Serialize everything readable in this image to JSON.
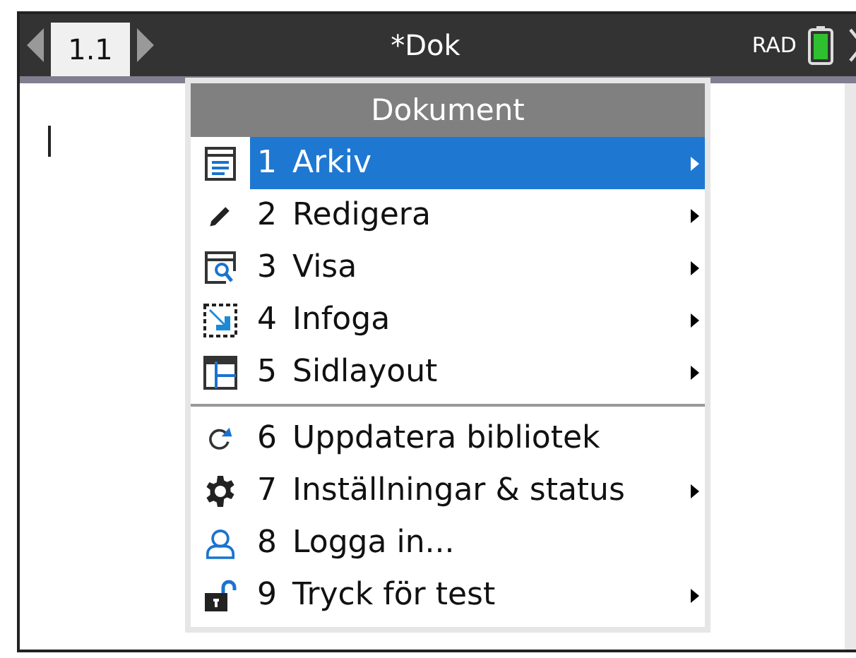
{
  "tab": {
    "label": "1.1",
    "selected": true
  },
  "document_title": "*Dok",
  "angle_mode": "RAD",
  "menu": {
    "title": "Dokument",
    "groups": [
      [
        {
          "number": "1",
          "label": "Arkiv",
          "selected": true,
          "has_submenu": true
        },
        {
          "number": "2",
          "label": "Redigera",
          "selected": false,
          "has_submenu": true
        },
        {
          "number": "3",
          "label": "Visa",
          "selected": false,
          "has_submenu": true
        },
        {
          "number": "4",
          "label": "Infoga",
          "selected": false,
          "has_submenu": true
        },
        {
          "number": "5",
          "label": "Sidlayout",
          "selected": false,
          "has_submenu": true
        }
      ],
      [
        {
          "number": "6",
          "label": "Uppdatera bibliotek",
          "selected": false,
          "has_submenu": false
        },
        {
          "number": "7",
          "label": "Inställningar & status",
          "selected": false,
          "has_submenu": true
        },
        {
          "number": "8",
          "label": "Logga in...",
          "selected": false,
          "has_submenu": false
        },
        {
          "number": "9",
          "label": "Tryck för test",
          "selected": false,
          "has_submenu": true
        }
      ]
    ]
  }
}
